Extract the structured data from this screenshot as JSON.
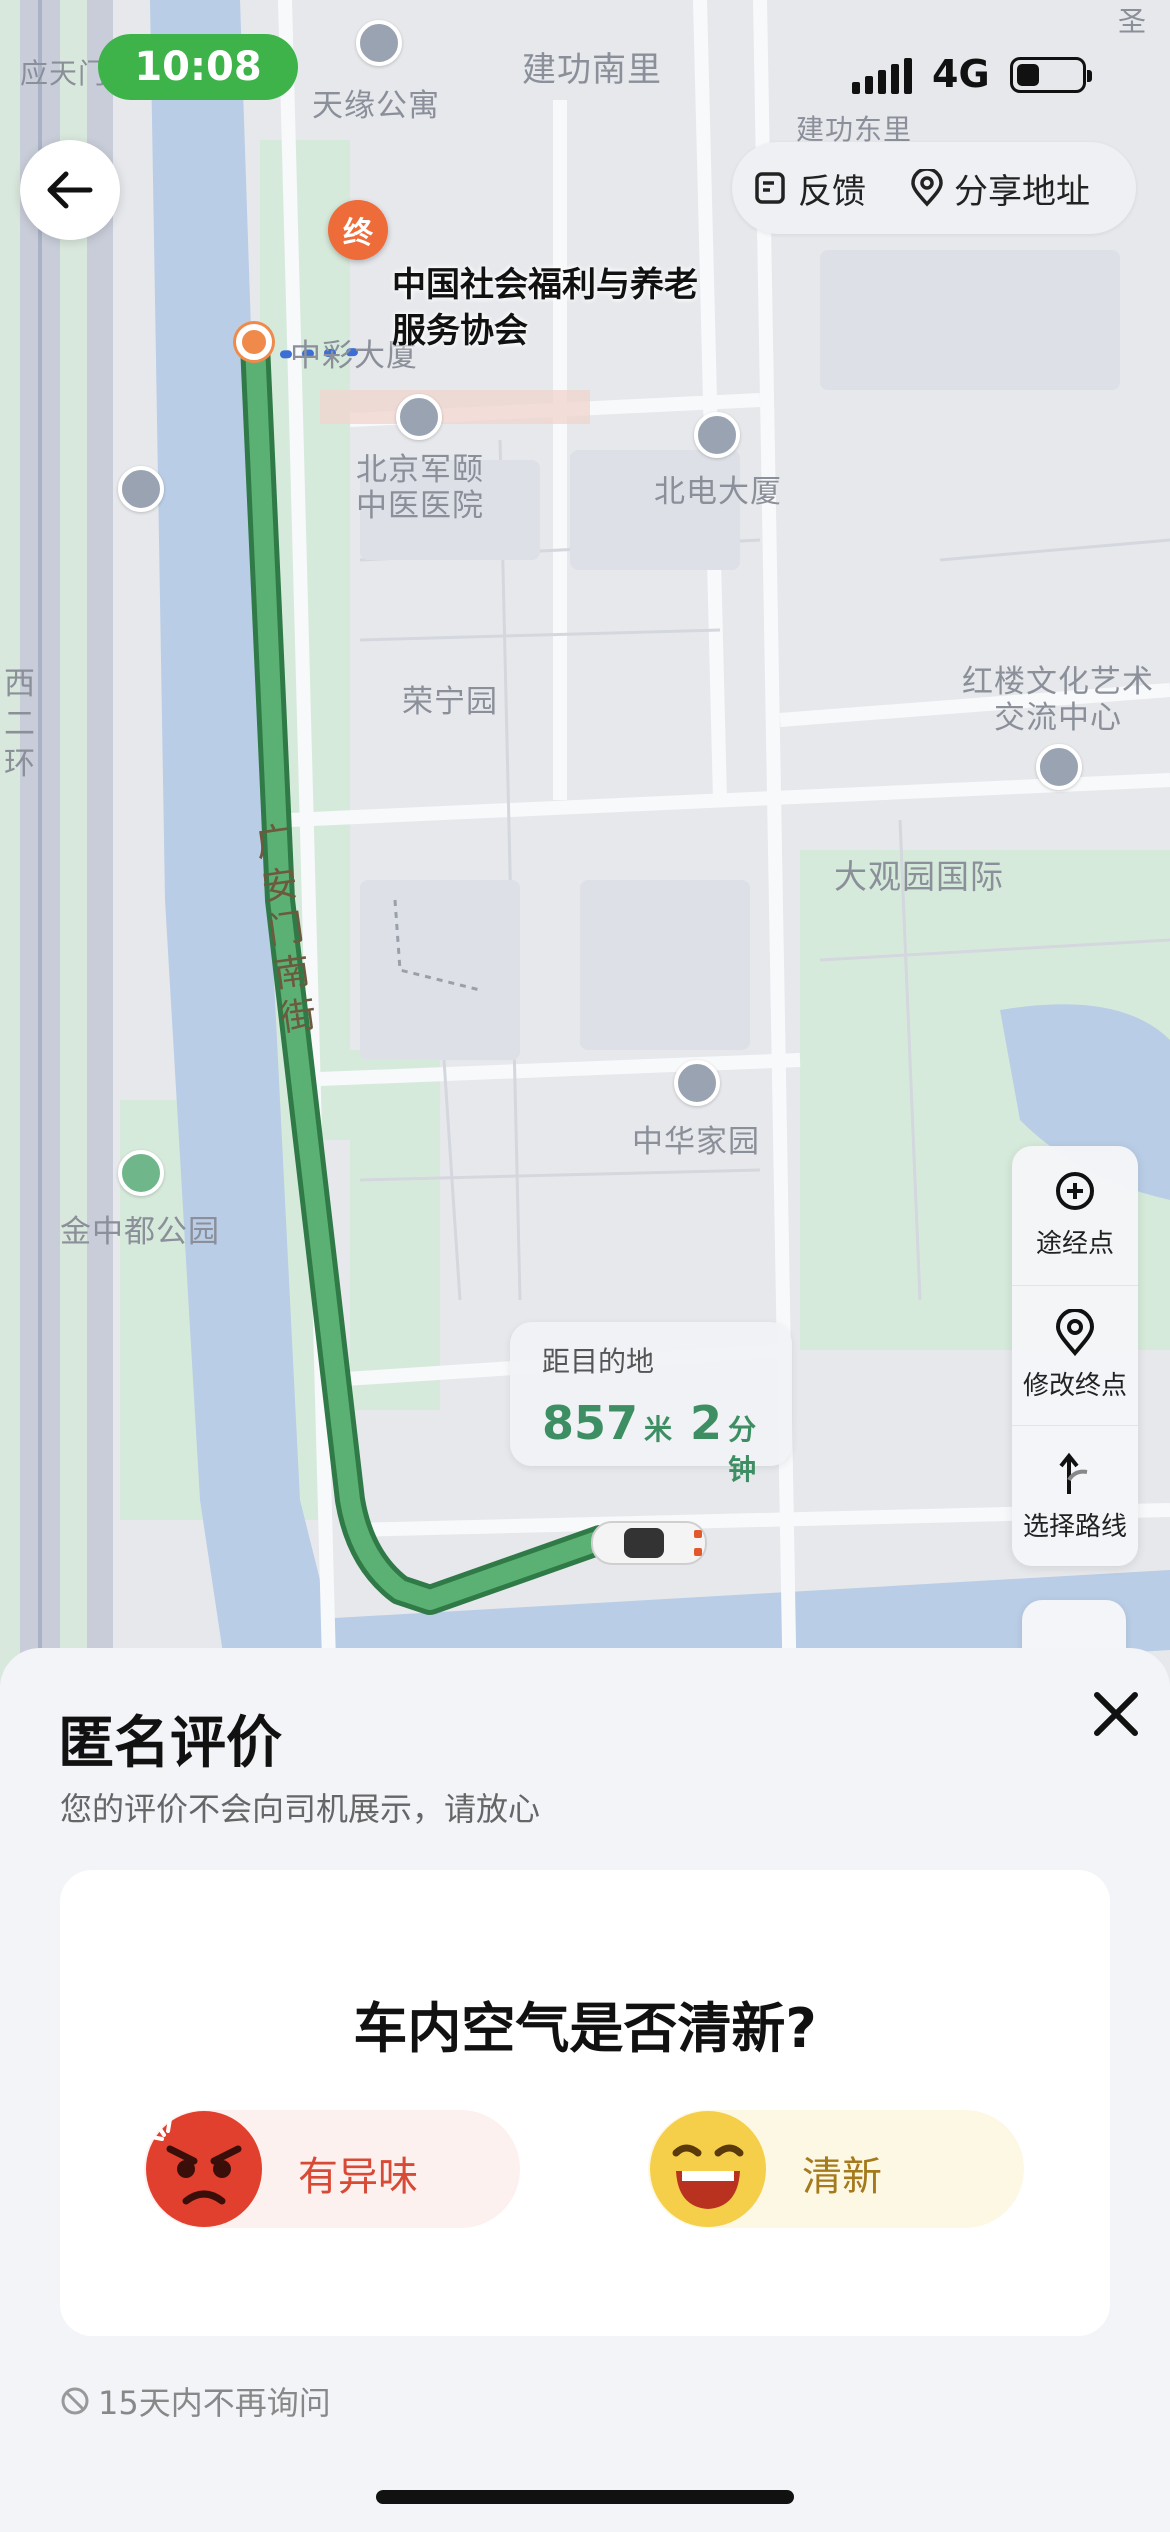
{
  "status_bar": {
    "time": "10:08",
    "network": "4G"
  },
  "top_actions": {
    "feedback": "反馈",
    "share": "分享地址"
  },
  "map": {
    "destination_marker": "终",
    "destination_name": "中国社会福利与养老服务协会",
    "labels": {
      "tianyuan": "天缘公寓",
      "jiangong_nan": "建功南里",
      "jiangong_dong": "建功东里",
      "zhongcai": "中彩大厦",
      "junyi": "北京军颐\n中医医院",
      "beidian": "北电大厦",
      "rongning": "荣宁园",
      "honglou": "红楼文化艺术\n交流中心",
      "daguanyuan": "大观园国际",
      "guanganmen": "广安门南街",
      "zhonghua": "中华家园",
      "jinzhongdu": "金中都公园",
      "xierhuan": "西二环",
      "yingtianmen": "应天门",
      "sheng": "圣"
    },
    "distance_card": {
      "title": "距目的地",
      "distance": "857",
      "distance_unit": "米",
      "time": "2",
      "time_unit": "分钟"
    },
    "tools": {
      "waypoint": "途经点",
      "edit_destination": "修改终点",
      "choose_route": "选择路线"
    }
  },
  "sheet": {
    "title": "匿名评价",
    "subtitle": "您的评价不会向司机展示，请放心",
    "question": "车内空气是否清新?",
    "option_bad": "有异味",
    "option_good": "清新",
    "footnote": "15天内不再询问"
  }
}
